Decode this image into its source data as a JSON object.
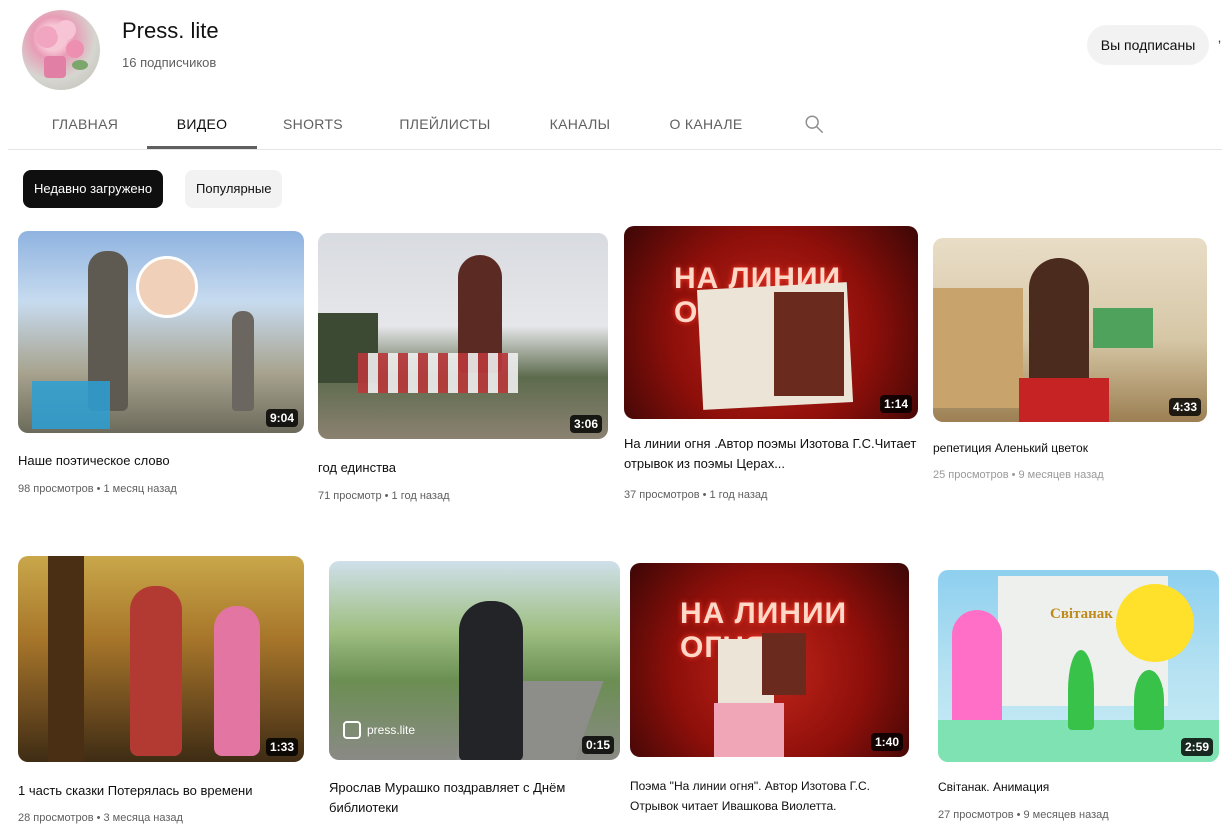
{
  "channel": {
    "name": "Press. lite",
    "subscribers": "16 подписчиков",
    "subscribe_label": "Вы подписаны",
    "edge_glyph": "ʼ"
  },
  "tabs": [
    {
      "label": "ГЛАВНАЯ",
      "active": false
    },
    {
      "label": "ВИДЕО",
      "active": true
    },
    {
      "label": "SHORTS",
      "active": false
    },
    {
      "label": "ПЛЕЙЛИСТЫ",
      "active": false
    },
    {
      "label": "КАНАЛЫ",
      "active": false
    },
    {
      "label": "О КАНАЛЕ",
      "active": false
    }
  ],
  "search_icon": "search-icon",
  "chips": [
    {
      "label": "Недавно загружено",
      "active": true
    },
    {
      "label": "Популярные",
      "active": false
    }
  ],
  "videos": [
    {
      "title": "Наше поэтическое слово",
      "meta": "98 просмотров • 1 месяц назад",
      "duration": "9:04"
    },
    {
      "title": "год единства",
      "meta": "71 просмотр • 1 год назад",
      "duration": "3:06"
    },
    {
      "title": "На линии огня .Автор поэмы Изотова Г.С.Читает отрывок из поэмы Церах...",
      "meta": "37 просмотров • 1 год назад",
      "duration": "1:14",
      "overlay": "НА ЛИНИИ ОГНЯ"
    },
    {
      "title": "репетиция Аленький цветок",
      "meta": "25 просмотров • 9 месяцев назад",
      "duration": "4:33"
    },
    {
      "title": "1 часть сказки Потерялась во времени",
      "meta": "28 просмотров • 3 месяца назад",
      "duration": "1:33"
    },
    {
      "title": "Ярослав Мурашко поздравляет с Днём библиотеки",
      "meta": "",
      "duration": "0:15",
      "watermark": "press.lite"
    },
    {
      "title": "Поэма \"На линии огня\". Автор Изотова Г.С. Отрывок читает Ивашкова Виолетта.",
      "meta": "",
      "duration": "1:40",
      "overlay": "НА ЛИНИИ ОГНЯ"
    },
    {
      "title": "Світанак. Анимация",
      "meta": "27 просмотров • 9 месяцев назад",
      "duration": "2:59",
      "sign": "Світанак"
    }
  ]
}
